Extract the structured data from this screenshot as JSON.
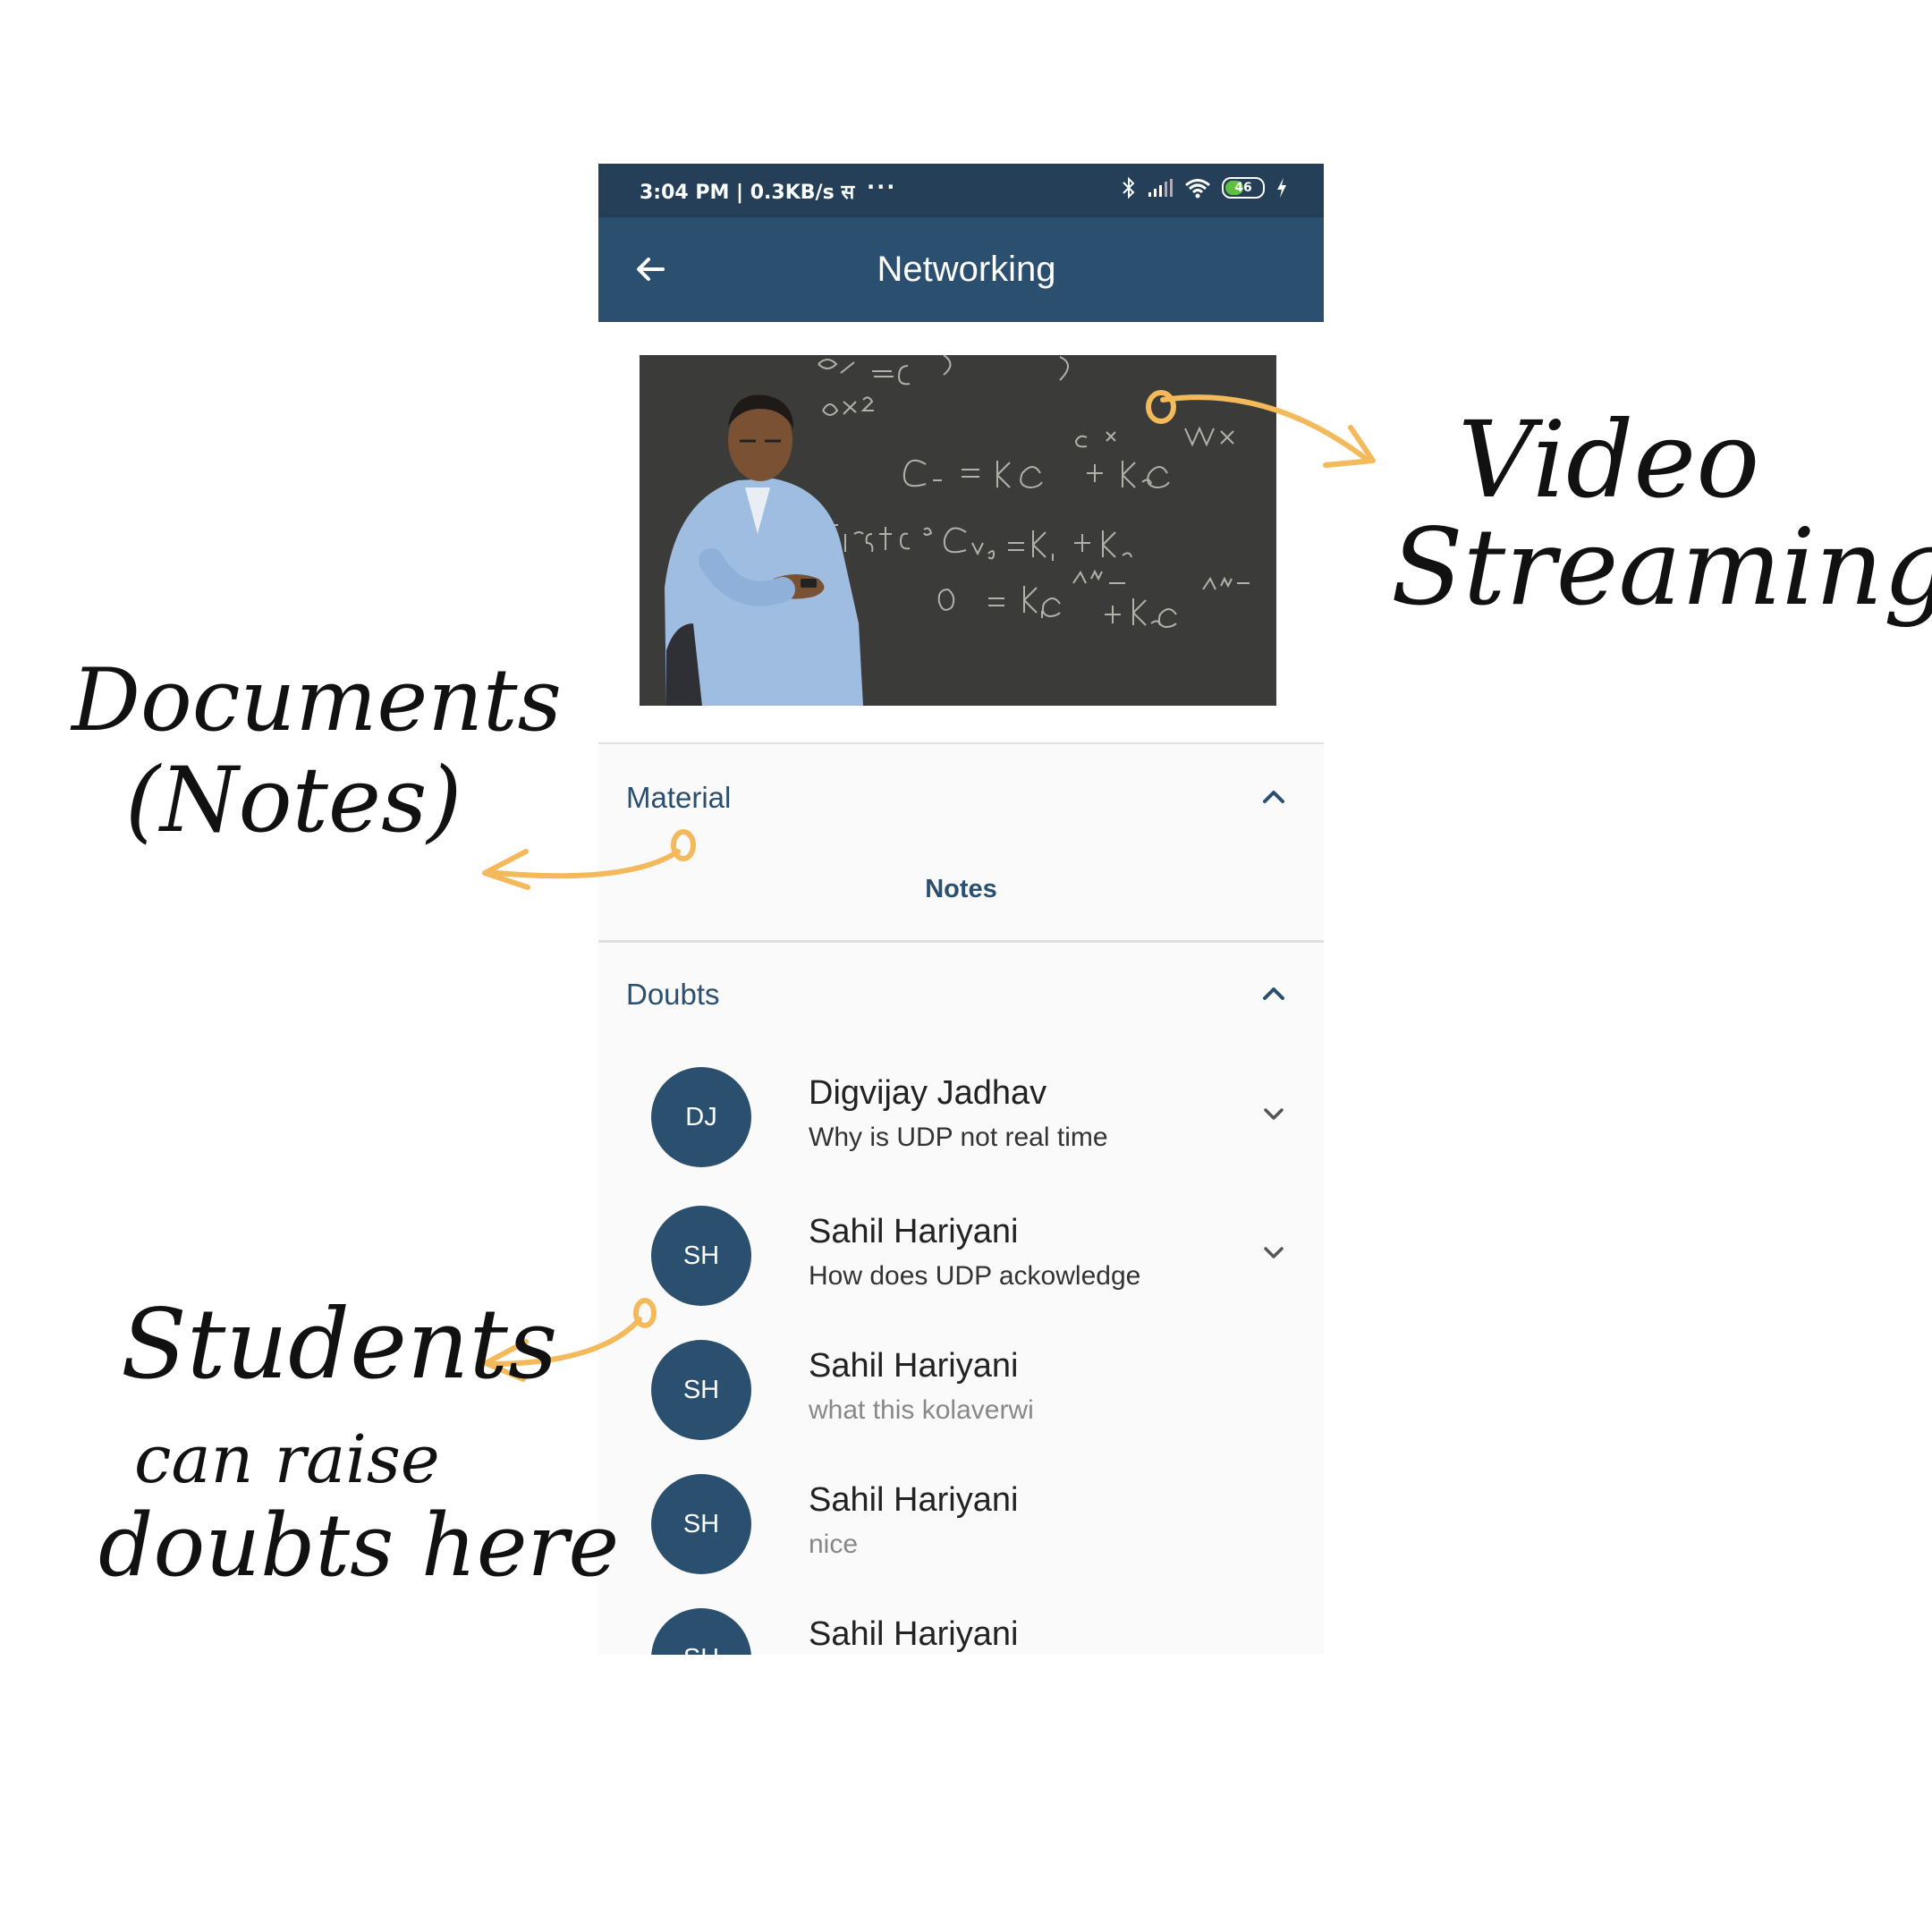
{
  "status_bar": {
    "time_speed": "3:04 PM | 0.3KB/s स",
    "overflow": "···",
    "battery": "46"
  },
  "app_bar": {
    "title": "Networking",
    "back_icon": "arrow-left-icon"
  },
  "material": {
    "title": "Material",
    "notes_label": "Notes"
  },
  "doubts": {
    "title": "Doubts",
    "items": [
      {
        "initials": "DJ",
        "name": "Digvijay Jadhav",
        "text": "Why is UDP not real time",
        "expandable": true
      },
      {
        "initials": "SH",
        "name": "Sahil Hariyani",
        "text": "How does UDP ackowledge",
        "expandable": true
      },
      {
        "initials": "SH",
        "name": "Sahil Hariyani",
        "text": "what this kolaverwi",
        "expandable": false
      },
      {
        "initials": "SH",
        "name": "Sahil Hariyani",
        "text": "nice",
        "expandable": false
      },
      {
        "initials": "SH",
        "name": "Sahil Hariyani",
        "text": "",
        "expandable": false
      }
    ]
  },
  "annotations": {
    "video_line1": "Video",
    "video_line2": "Streaming",
    "docs_line1": "Documents",
    "docs_line2": "(Notes)",
    "students_line1": "Students",
    "students_line2": "can raise",
    "students_line3": "doubts here"
  },
  "colors": {
    "primary": "#2b4f6e",
    "status_bar": "#243f57",
    "arrow": "#f4b95a"
  }
}
